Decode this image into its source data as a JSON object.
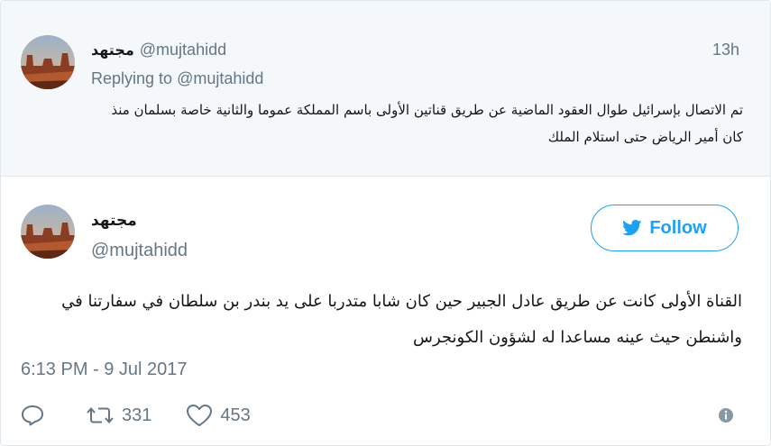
{
  "parent": {
    "display_name": "مجتهد",
    "handle": "@mujtahidd",
    "time": "13h",
    "replying_label": "Replying to",
    "replying_handle": "@mujtahidd",
    "text": "تم الاتصال بإسرائيل طوال العقود الماضية عن طريق قناتين الأولى باسم المملكة عموما والثانية خاصة بسلمان منذ كان أمير الرياض حتى استلام الملك"
  },
  "tweet": {
    "display_name": "مجتهد",
    "handle": "@mujtahidd",
    "follow_label": "Follow",
    "text": "القناة الأولى كانت عن طريق عادل الجبير حين كان شابا متدربا على يد بندر بن سلطان في سفارتنا في واشنطن حيث عينه مساعدا له لشؤون الكونجرس",
    "date": "6:13 PM - 9 Jul 2017",
    "retweets": "331",
    "likes": "453"
  },
  "icons": {
    "reply": "reply-icon",
    "retweet": "retweet-icon",
    "like": "heart-icon",
    "info": "info-icon",
    "follow": "twitter-bird-icon"
  },
  "colors": {
    "accent": "#1da1f2",
    "muted": "#657786",
    "parent_bg": "#f5f8fa"
  }
}
